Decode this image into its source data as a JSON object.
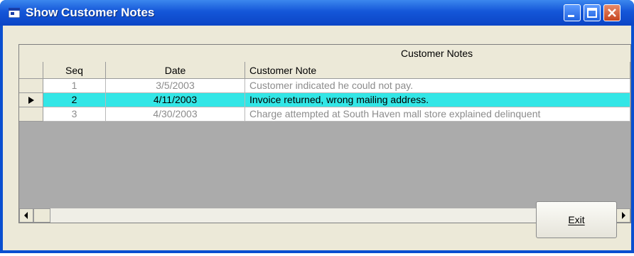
{
  "window": {
    "title": "Show Customer Notes"
  },
  "grid": {
    "caption": "Customer Notes",
    "columns": [
      "Seq",
      "Date",
      "Customer Note"
    ],
    "rows": [
      {
        "seq": "1",
        "date": "3/5/2003",
        "note": "Customer indicated he could not pay."
      },
      {
        "seq": "2",
        "date": "4/11/2003",
        "note": "Invoice returned, wrong mailing address."
      },
      {
        "seq": "3",
        "date": "4/30/2003",
        "note": "Charge attempted at South Haven mall store explained delinquent"
      }
    ],
    "selected_row": 2
  },
  "buttons": {
    "exit_label": "Exit"
  },
  "colors": {
    "selected_row": "#33e6e6",
    "title_bar": "#0b45c6",
    "dim_text": "#8c8c8c"
  }
}
